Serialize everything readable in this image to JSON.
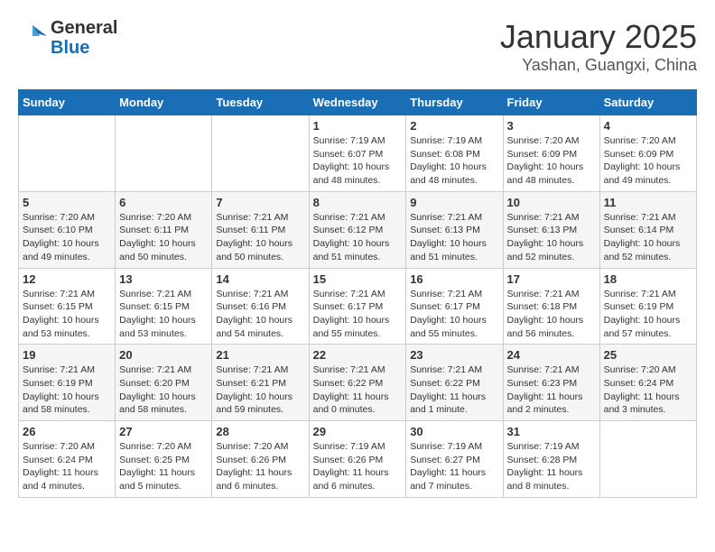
{
  "header": {
    "logo_line1": "General",
    "logo_line2": "Blue",
    "title": "January 2025",
    "subtitle": "Yashan, Guangxi, China"
  },
  "days_of_week": [
    "Sunday",
    "Monday",
    "Tuesday",
    "Wednesday",
    "Thursday",
    "Friday",
    "Saturday"
  ],
  "weeks": [
    [
      {
        "day": "",
        "info": ""
      },
      {
        "day": "",
        "info": ""
      },
      {
        "day": "",
        "info": ""
      },
      {
        "day": "1",
        "info": "Sunrise: 7:19 AM\nSunset: 6:07 PM\nDaylight: 10 hours\nand 48 minutes."
      },
      {
        "day": "2",
        "info": "Sunrise: 7:19 AM\nSunset: 6:08 PM\nDaylight: 10 hours\nand 48 minutes."
      },
      {
        "day": "3",
        "info": "Sunrise: 7:20 AM\nSunset: 6:09 PM\nDaylight: 10 hours\nand 48 minutes."
      },
      {
        "day": "4",
        "info": "Sunrise: 7:20 AM\nSunset: 6:09 PM\nDaylight: 10 hours\nand 49 minutes."
      }
    ],
    [
      {
        "day": "5",
        "info": "Sunrise: 7:20 AM\nSunset: 6:10 PM\nDaylight: 10 hours\nand 49 minutes."
      },
      {
        "day": "6",
        "info": "Sunrise: 7:20 AM\nSunset: 6:11 PM\nDaylight: 10 hours\nand 50 minutes."
      },
      {
        "day": "7",
        "info": "Sunrise: 7:21 AM\nSunset: 6:11 PM\nDaylight: 10 hours\nand 50 minutes."
      },
      {
        "day": "8",
        "info": "Sunrise: 7:21 AM\nSunset: 6:12 PM\nDaylight: 10 hours\nand 51 minutes."
      },
      {
        "day": "9",
        "info": "Sunrise: 7:21 AM\nSunset: 6:13 PM\nDaylight: 10 hours\nand 51 minutes."
      },
      {
        "day": "10",
        "info": "Sunrise: 7:21 AM\nSunset: 6:13 PM\nDaylight: 10 hours\nand 52 minutes."
      },
      {
        "day": "11",
        "info": "Sunrise: 7:21 AM\nSunset: 6:14 PM\nDaylight: 10 hours\nand 52 minutes."
      }
    ],
    [
      {
        "day": "12",
        "info": "Sunrise: 7:21 AM\nSunset: 6:15 PM\nDaylight: 10 hours\nand 53 minutes."
      },
      {
        "day": "13",
        "info": "Sunrise: 7:21 AM\nSunset: 6:15 PM\nDaylight: 10 hours\nand 53 minutes."
      },
      {
        "day": "14",
        "info": "Sunrise: 7:21 AM\nSunset: 6:16 PM\nDaylight: 10 hours\nand 54 minutes."
      },
      {
        "day": "15",
        "info": "Sunrise: 7:21 AM\nSunset: 6:17 PM\nDaylight: 10 hours\nand 55 minutes."
      },
      {
        "day": "16",
        "info": "Sunrise: 7:21 AM\nSunset: 6:17 PM\nDaylight: 10 hours\nand 55 minutes."
      },
      {
        "day": "17",
        "info": "Sunrise: 7:21 AM\nSunset: 6:18 PM\nDaylight: 10 hours\nand 56 minutes."
      },
      {
        "day": "18",
        "info": "Sunrise: 7:21 AM\nSunset: 6:19 PM\nDaylight: 10 hours\nand 57 minutes."
      }
    ],
    [
      {
        "day": "19",
        "info": "Sunrise: 7:21 AM\nSunset: 6:19 PM\nDaylight: 10 hours\nand 58 minutes."
      },
      {
        "day": "20",
        "info": "Sunrise: 7:21 AM\nSunset: 6:20 PM\nDaylight: 10 hours\nand 58 minutes."
      },
      {
        "day": "21",
        "info": "Sunrise: 7:21 AM\nSunset: 6:21 PM\nDaylight: 10 hours\nand 59 minutes."
      },
      {
        "day": "22",
        "info": "Sunrise: 7:21 AM\nSunset: 6:22 PM\nDaylight: 11 hours\nand 0 minutes."
      },
      {
        "day": "23",
        "info": "Sunrise: 7:21 AM\nSunset: 6:22 PM\nDaylight: 11 hours\nand 1 minute."
      },
      {
        "day": "24",
        "info": "Sunrise: 7:21 AM\nSunset: 6:23 PM\nDaylight: 11 hours\nand 2 minutes."
      },
      {
        "day": "25",
        "info": "Sunrise: 7:20 AM\nSunset: 6:24 PM\nDaylight: 11 hours\nand 3 minutes."
      }
    ],
    [
      {
        "day": "26",
        "info": "Sunrise: 7:20 AM\nSunset: 6:24 PM\nDaylight: 11 hours\nand 4 minutes."
      },
      {
        "day": "27",
        "info": "Sunrise: 7:20 AM\nSunset: 6:25 PM\nDaylight: 11 hours\nand 5 minutes."
      },
      {
        "day": "28",
        "info": "Sunrise: 7:20 AM\nSunset: 6:26 PM\nDaylight: 11 hours\nand 6 minutes."
      },
      {
        "day": "29",
        "info": "Sunrise: 7:19 AM\nSunset: 6:26 PM\nDaylight: 11 hours\nand 6 minutes."
      },
      {
        "day": "30",
        "info": "Sunrise: 7:19 AM\nSunset: 6:27 PM\nDaylight: 11 hours\nand 7 minutes."
      },
      {
        "day": "31",
        "info": "Sunrise: 7:19 AM\nSunset: 6:28 PM\nDaylight: 11 hours\nand 8 minutes."
      },
      {
        "day": "",
        "info": ""
      }
    ]
  ]
}
